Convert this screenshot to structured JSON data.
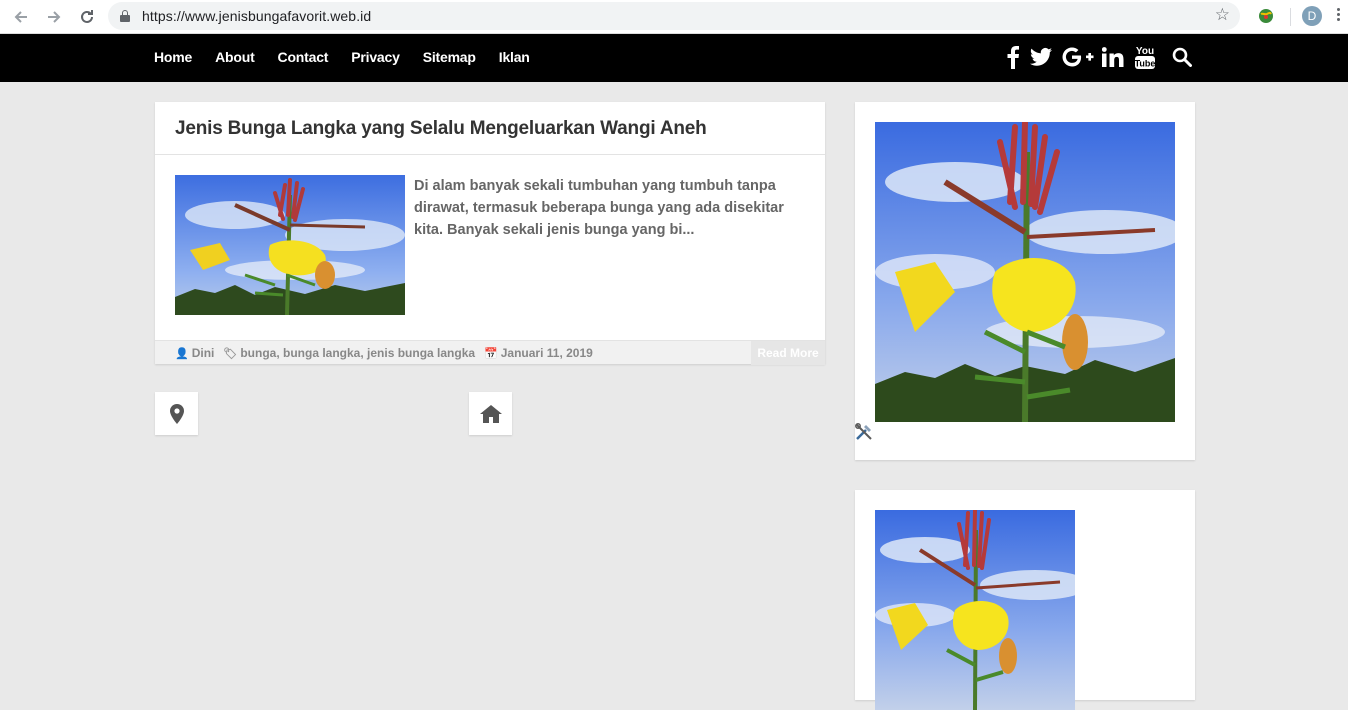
{
  "browser": {
    "url": "https://www.jenisbungafavorit.web.id",
    "profile_initial": "D",
    "icons": [
      "back-arrow-icon",
      "forward-arrow-icon",
      "reload-icon",
      "lock-icon",
      "star-icon",
      "extension-icon",
      "menu-dots-icon"
    ]
  },
  "site": {
    "menu": [
      "Home",
      "About",
      "Contact",
      "Privacy",
      "Sitemap",
      "Iklan"
    ],
    "social_icons": [
      "facebook-icon",
      "twitter-icon",
      "google-plus-icon",
      "linkedin-icon",
      "youtube-icon",
      "search-icon"
    ]
  },
  "post": {
    "title": "Jenis Bunga Langka yang Selalu Mengeluarkan Wangi Aneh",
    "excerpt": "Di alam banyak sekali tumbuhan yang tumbuh tanpa dirawat, termasuk beberapa bunga yang ada disekitar kita. Banyak sekali jenis bunga yang bi...",
    "author": "Dini",
    "tags": "bunga, bunga langka, jenis bunga langka",
    "date": "Januari 11, 2019",
    "read_more": "Read More"
  },
  "pager_icons": [
    "map-marker-icon",
    "home-icon"
  ],
  "colors": {
    "nav_bg": "#000000",
    "page_bg": "#e9e9e9",
    "card_bg": "#ffffff"
  }
}
